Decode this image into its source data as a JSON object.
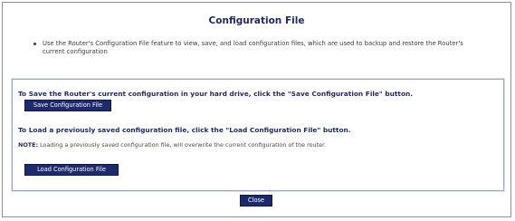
{
  "dialog": {
    "title": "Configuration File",
    "description": "Use the Router's Configuration File feature to view, save, and load configuration files, which are used to backup and restore the Router's current configuration"
  },
  "save_section": {
    "instruction": "To Save the Router's current configuration in your hard drive, click the \"Save Configuration File\" button.",
    "button_label": "Save Configuration File"
  },
  "load_section": {
    "instruction": "To Load a previously saved configuration file, click the \"Load Configuration File\" button.",
    "note_label": "NOTE:",
    "note_text": " Loading a previously saved configuration file, will overwrite the current configuration of the router.",
    "button_label": "Load Configuration File"
  },
  "footer": {
    "close_label": "Close"
  }
}
